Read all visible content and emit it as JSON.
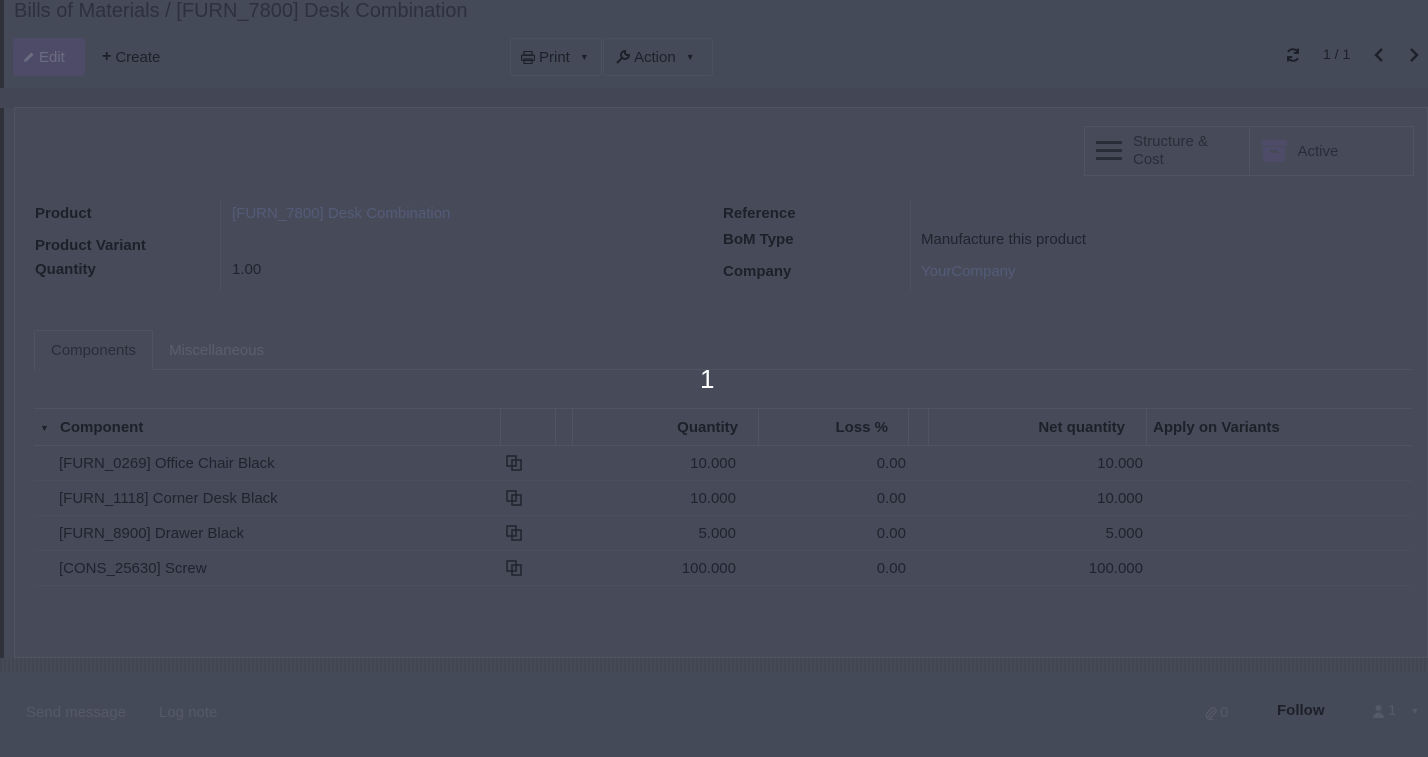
{
  "breadcrumb": {
    "parent": "Bills of Materials",
    "separator": "/",
    "current": "[FURN_7800] Desk Combination"
  },
  "toolbar": {
    "edit_label": "Edit",
    "create_label": "Create",
    "print_label": "Print",
    "action_label": "Action",
    "pager": "1 / 1"
  },
  "smart_buttons": {
    "structure_cost": "Structure & Cost",
    "active": "Active"
  },
  "form": {
    "product_label": "Product",
    "product_value": "[FURN_7800] Desk Combination",
    "variant_label": "Product Variant",
    "variant_value": "",
    "quantity_label": "Quantity",
    "quantity_value": "1.00",
    "reference_label": "Reference",
    "reference_value": "",
    "bom_type_label": "BoM Type",
    "bom_type_value": "Manufacture this product",
    "company_label": "Company",
    "company_value": "YourCompany"
  },
  "tabs": [
    "Components",
    "Miscellaneous"
  ],
  "step_number": "1",
  "table": {
    "headers": {
      "component": "Component",
      "quantity": "Quantity",
      "loss": "Loss %",
      "net_quantity": "Net quantity",
      "apply_on_variants": "Apply on Variants"
    },
    "rows": [
      {
        "component": "[FURN_0269] Office Chair Black",
        "quantity": "10.000",
        "loss": "0.00",
        "net_quantity": "10.000"
      },
      {
        "component": "[FURN_1118] Corner Desk Black",
        "quantity": "10.000",
        "loss": "0.00",
        "net_quantity": "10.000"
      },
      {
        "component": "[FURN_8900] Drawer Black",
        "quantity": "5.000",
        "loss": "0.00",
        "net_quantity": "5.000"
      },
      {
        "component": "[CONS_25630] Screw",
        "quantity": "100.000",
        "loss": "0.00",
        "net_quantity": "100.000"
      }
    ]
  },
  "chatter": {
    "send_message": "Send message",
    "log_note": "Log note",
    "attachments_count": "0",
    "follow": "Follow",
    "followers_count": "1"
  }
}
